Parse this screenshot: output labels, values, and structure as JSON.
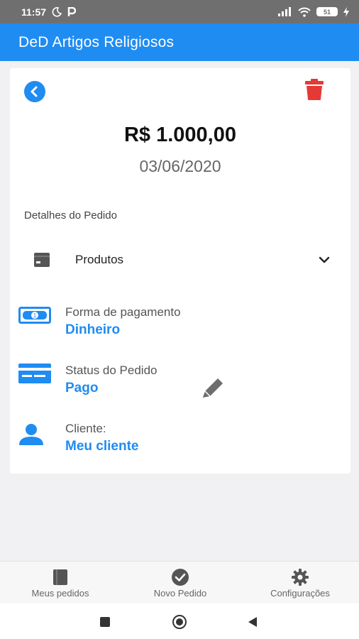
{
  "status_bar": {
    "time": "11:57",
    "battery": "51"
  },
  "app_bar": {
    "title": "DeD Artigos Religiosos"
  },
  "order": {
    "amount": "R$ 1.000,00",
    "date": "03/06/2020",
    "details_title": "Detalhes do Pedido",
    "products_label": "Produtos",
    "payment": {
      "label": "Forma de pagamento",
      "value": "Dinheiro"
    },
    "status": {
      "label": "Status do Pedido",
      "value": "Pago"
    },
    "client": {
      "label": "Cliente:",
      "value": "Meu cliente"
    }
  },
  "bottom_nav": {
    "items": [
      {
        "label": "Meus pedidos",
        "icon": "book-icon"
      },
      {
        "label": "Novo Pedido",
        "icon": "check-circle-icon"
      },
      {
        "label": "Configurações",
        "icon": "gear-icon"
      }
    ]
  },
  "colors": {
    "primary": "#1f8cf2",
    "delete": "#e53935",
    "status_bar": "#6f6f70"
  }
}
